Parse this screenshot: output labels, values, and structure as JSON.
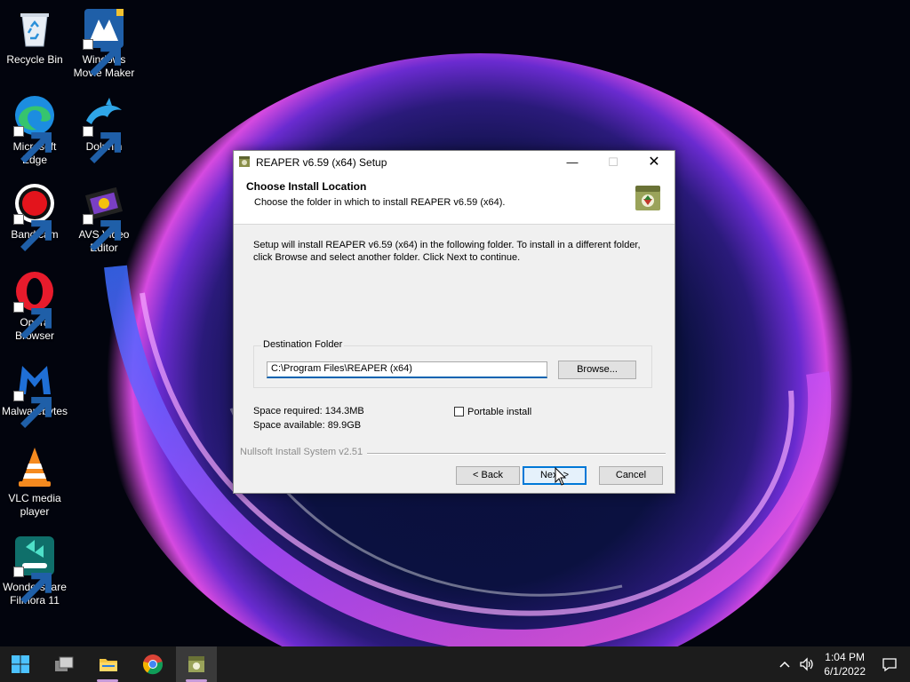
{
  "desktop": {
    "icons": [
      {
        "label": "Recycle Bin"
      },
      {
        "label": "Windows Movie Maker"
      },
      {
        "label": "Microsoft Edge"
      },
      {
        "label": "Dolphin"
      },
      {
        "label": "Bandicam"
      },
      {
        "label": "AVS Video Editor"
      },
      {
        "label": "Opera Browser"
      },
      {
        "label": "Malwarebytes"
      },
      {
        "label": "VLC media player"
      },
      {
        "label": "Wondershare Filmora 11"
      }
    ]
  },
  "window": {
    "title": "REAPER v6.59 (x64) Setup",
    "header_title": "Choose Install Location",
    "header_subtitle": "Choose the folder in which to install REAPER v6.59 (x64).",
    "intro_text": "Setup will install REAPER v6.59 (x64) in the following folder. To install in a different folder, click Browse and select another folder. Click Next to continue.",
    "destination_legend": "Destination Folder",
    "destination_path": "C:\\Program Files\\REAPER (x64)",
    "browse_label": "Browse...",
    "space_required": "Space required: 134.3MB",
    "space_available": "Space available: 89.9GB",
    "portable_label": "Portable install",
    "portable_checked": false,
    "nsis_label": "Nullsoft Install System v2.51",
    "back_label": "< Back",
    "next_label": "Next >",
    "cancel_label": "Cancel"
  },
  "taskbar": {
    "time": "1:04 PM",
    "date": "6/1/2022",
    "apps": [
      "start-icon",
      "task-view-icon",
      "file-explorer-icon",
      "chrome-icon",
      "reaper-setup-icon"
    ]
  },
  "colors": {
    "accent": "#0078d7",
    "taskbar": "#1c1c1c",
    "window_bg": "#f0f0f0"
  }
}
